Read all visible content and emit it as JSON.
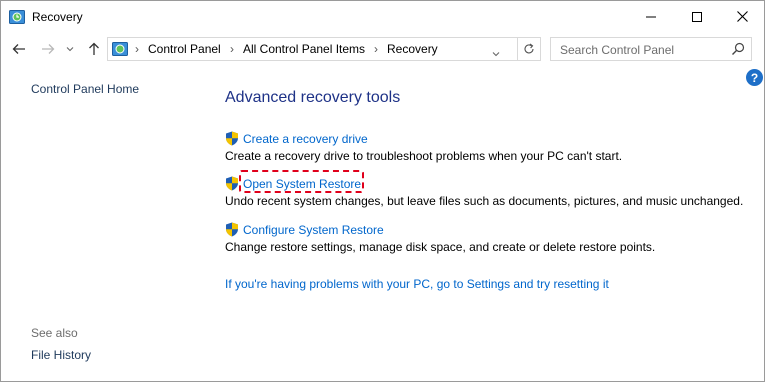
{
  "window": {
    "title": "Recovery",
    "icon": "recovery-app-icon",
    "controls": [
      "minimize-icon",
      "maximize-icon",
      "close-icon"
    ]
  },
  "navigation": {
    "back_icon": "back-arrow-icon",
    "forward_icon": "forward-arrow-icon",
    "recent_icon": "chevron-down-icon",
    "up_icon": "up-arrow-icon",
    "breadcrumb": [
      "Control Panel",
      "All Control Panel Items",
      "Recovery"
    ],
    "refresh_icon": "refresh-icon",
    "search_placeholder": "Search Control Panel"
  },
  "help": {
    "label": "?"
  },
  "left_pane": {
    "home_link": "Control Panel Home",
    "see_also_label": "See also",
    "see_also_items": [
      "File History"
    ]
  },
  "main": {
    "heading": "Advanced recovery tools",
    "tools": [
      {
        "link": "Create a recovery drive",
        "description": "Create a recovery drive to troubleshoot problems when your PC can't start."
      },
      {
        "link": "Open System Restore",
        "description": "Undo recent system changes, but leave files such as documents, pictures, and music unchanged."
      },
      {
        "link": "Configure System Restore",
        "description": "Change restore settings, manage disk space, and create or delete restore points."
      }
    ],
    "reset_link": "If you're having problems with your PC, go to Settings and try resetting it"
  },
  "colors": {
    "link": "#0066cc",
    "heading": "#1e3287",
    "highlight": "#e0001b",
    "help_button": "#1e6fc8"
  }
}
